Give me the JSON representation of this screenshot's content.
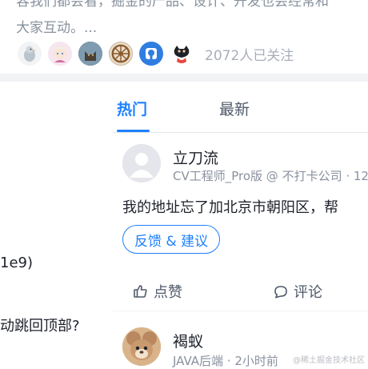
{
  "intro": {
    "line1": "容我们都会看，掘金的产品、设计、开发也会经常和",
    "line2": "大家互动。...",
    "follow_count": "2072人已关注",
    "follower_icons": [
      "bird-icon",
      "anime-avatar-icon",
      "cat-icon",
      "wagon-wheel-icon",
      "github-icon",
      "octocat-icon"
    ]
  },
  "background": {
    "text1": "1e9)",
    "text2": "动跳回顶部?"
  },
  "tabs": {
    "hot": "热门",
    "latest": "最新"
  },
  "comments": [
    {
      "name": "立刀流",
      "meta": "CV工程师_Pro版 @ 不打卡公司 · 12",
      "text": "我的地址忘了加北京市朝阳区，帮",
      "tag": "反馈 & 建议",
      "like_label": "点赞",
      "comment_label": "评论"
    },
    {
      "name": "褐蚁",
      "meta": "JAVA后端 · 2小时前"
    }
  ],
  "watermark": "@稀土掘金技术社区",
  "colors": {
    "accent": "#1e80ff",
    "muted_text": "#86909c",
    "divider": "#f2f3f5"
  }
}
